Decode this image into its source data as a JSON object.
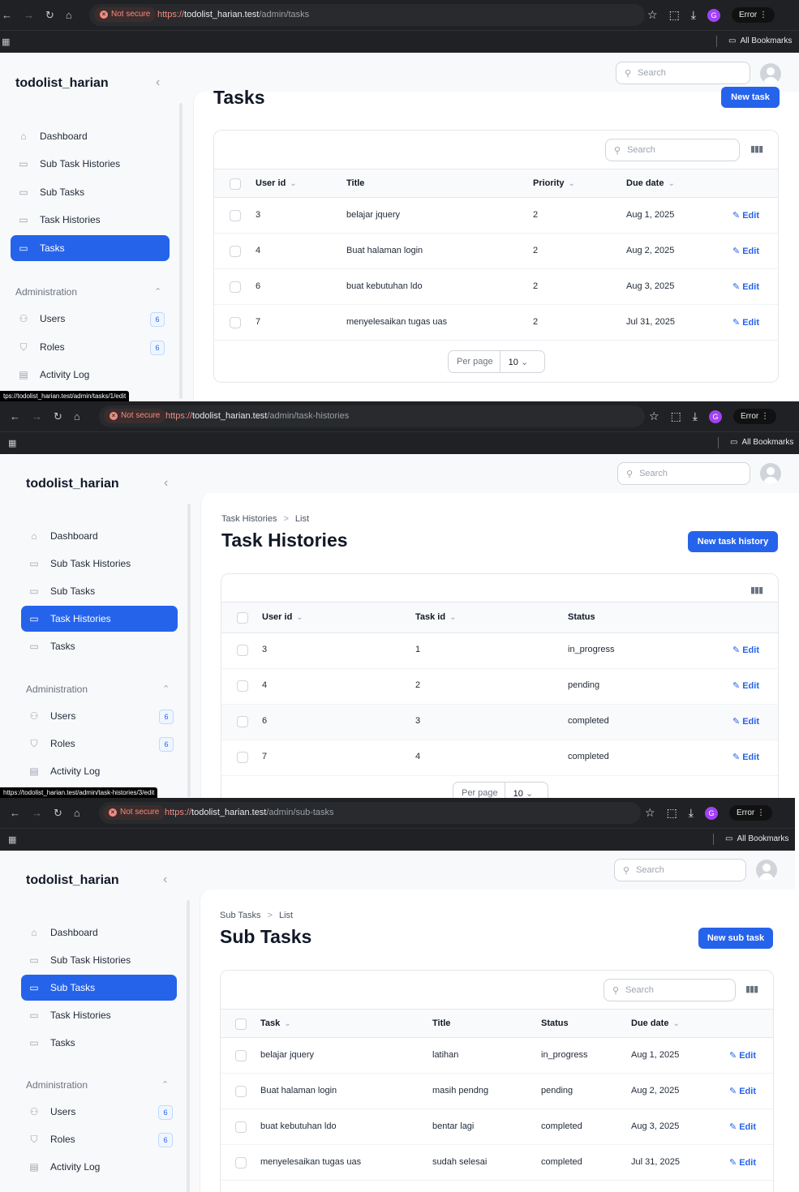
{
  "browser": {
    "not_secure": "Not secure",
    "error_label": "Error",
    "profile_initial": "G",
    "all_bookmarks": "All Bookmarks",
    "scheme": "https://",
    "host": "todolist_harian.test"
  },
  "app": {
    "brand": "todolist_harian",
    "search_placeholder": "Search",
    "nav_items": [
      "Dashboard",
      "Sub Task Histories",
      "Sub Tasks",
      "Task Histories",
      "Tasks"
    ],
    "admin_group": "Administration",
    "admin_items": [
      "Users",
      "Roles",
      "Activity Log"
    ],
    "users_count": "6",
    "roles_count": "6",
    "edit_label": "Edit",
    "per_page_label": "Per page",
    "per_page_value": "10"
  },
  "screens": [
    {
      "path": "/admin/tasks",
      "title": "Tasks",
      "new_button": "New task",
      "status_url": "tps://todolist_harian.test/admin/tasks/1/edit",
      "columns": [
        "User id",
        "Title",
        "Priority",
        "Due date"
      ],
      "rows": [
        [
          "3",
          "belajar jquery",
          "2",
          "Aug 1, 2025"
        ],
        [
          "4",
          "Buat halaman login",
          "2",
          "Aug 2, 2025"
        ],
        [
          "6",
          "buat kebutuhan ldo",
          "2",
          "Aug 3, 2025"
        ],
        [
          "7",
          "menyelesaikan tugas uas",
          "2",
          "Jul 31, 2025"
        ]
      ]
    },
    {
      "path": "/admin/task-histories",
      "breadcrumb": [
        "Task Histories",
        "List"
      ],
      "title": "Task Histories",
      "new_button": "New task history",
      "status_url": "https://todolist_harian.test/admin/task-histories/3/edit",
      "columns": [
        "User id",
        "Task id",
        "Status"
      ],
      "rows": [
        [
          "3",
          "1",
          "in_progress"
        ],
        [
          "4",
          "2",
          "pending"
        ],
        [
          "6",
          "3",
          "completed"
        ],
        [
          "7",
          "4",
          "completed"
        ]
      ]
    },
    {
      "path": "/admin/sub-tasks",
      "breadcrumb": [
        "Sub Tasks",
        "List"
      ],
      "title": "Sub Tasks",
      "new_button": "New sub task",
      "columns": [
        "Task",
        "Title",
        "Status",
        "Due date"
      ],
      "rows": [
        [
          "belajar jquery",
          "latihan",
          "in_progress",
          "Aug 1, 2025"
        ],
        [
          "Buat halaman login",
          "masih pendng",
          "pending",
          "Aug 2, 2025"
        ],
        [
          "buat kebutuhan ldo",
          "bentar lagi",
          "completed",
          "Aug 3, 2025"
        ],
        [
          "menyelesaikan tugas uas",
          "sudah selesai",
          "completed",
          "Jul 31, 2025"
        ]
      ]
    }
  ]
}
